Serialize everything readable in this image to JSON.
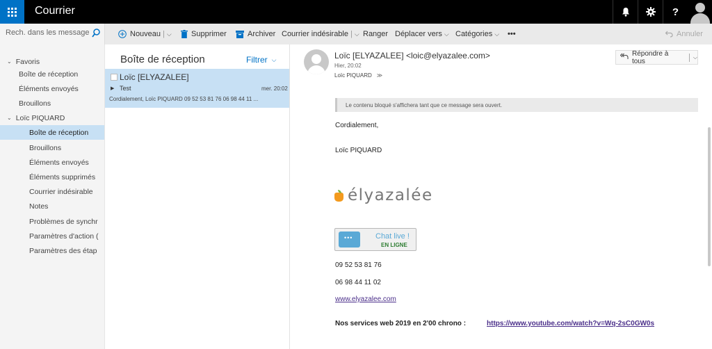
{
  "app": {
    "title": "Courrier"
  },
  "search": {
    "placeholder": "Rech. dans les messages e..."
  },
  "toolbar": {
    "new": "Nouveau",
    "delete": "Supprimer",
    "archive": "Archiver",
    "junk": "Courrier indésirable",
    "sweep": "Ranger",
    "move": "Déplacer vers",
    "categories": "Catégories",
    "more": "•••",
    "undo": "Annuler"
  },
  "nav": {
    "favorites_label": "Favoris",
    "favorites": [
      "Boîte de réception",
      "Éléments envoyés",
      "Brouillons"
    ],
    "account_label": "Loïc PIQUARD",
    "folders": [
      "Boîte de réception",
      "Brouillons",
      "Éléments envoyés",
      "Éléments supprimés",
      "Courrier indésirable",
      "Notes",
      "Problèmes de synchr",
      "Paramètres d'action (",
      "Paramètres des étap"
    ]
  },
  "list": {
    "title": "Boîte de réception",
    "filter": "Filtrer",
    "messages": [
      {
        "sender": "Loïc [ELYAZALEE]",
        "subject": "Test",
        "time": "mer. 20:02",
        "preview": "Cordialement, Loïc PIQUARD 09 52 53 81 76 06 98 44 11 ..."
      }
    ]
  },
  "reader": {
    "from": "Loïc [ELYAZALEE] <loic@elyazalee.com>",
    "date": "Hier, 20:02",
    "to": "Loïc PIQUARD",
    "reply_all": "Répondre à tous",
    "blocked_notice": "Le contenu bloqué s'affichera tant que ce message sera ouvert.",
    "greeting": "Cordialement,",
    "signature_name": "Loïc PIQUARD",
    "logo_text": "élyazalée",
    "chat_line1": "Chat live !",
    "chat_line2": "EN LIGNE",
    "phone1": "09 52 53 81 76",
    "phone2": "06 98 44 11 02",
    "website": "www.elyazalee.com",
    "promo_label": "Nos services web 2019 en 2'00 chrono :",
    "promo_link": "https://www.youtube.com/watch?v=Wq-2sC0GW0s"
  },
  "colors": {
    "accent": "#0072c6",
    "topbar": "#000000",
    "selected": "#c7e0f4",
    "link": "#4b2f8a",
    "brand_orange": "#f39a1e"
  }
}
